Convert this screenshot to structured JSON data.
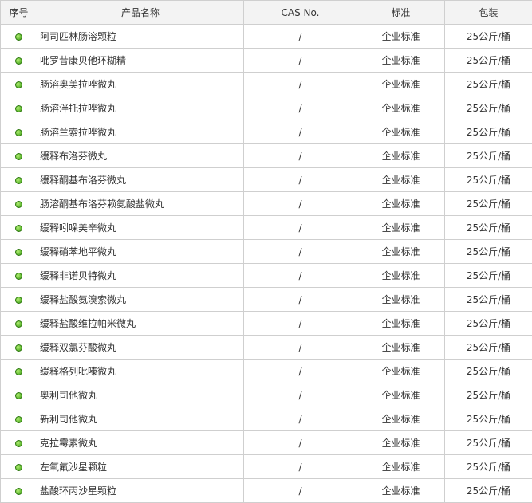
{
  "table": {
    "headers": [
      "序号",
      "产品名称",
      "CAS No.",
      "标准",
      "包装"
    ],
    "rows": [
      {
        "name": "阿司匹林肠溶颗粒",
        "cas": "/",
        "standard": "企业标准",
        "package": "25公斤/桶"
      },
      {
        "name": "吡罗昔康贝他环糊精",
        "cas": "/",
        "standard": "企业标准",
        "package": "25公斤/桶"
      },
      {
        "name": "肠溶奥美拉唑微丸",
        "cas": "/",
        "standard": "企业标准",
        "package": "25公斤/桶"
      },
      {
        "name": "肠溶泮托拉唑微丸",
        "cas": "/",
        "standard": "企业标准",
        "package": "25公斤/桶"
      },
      {
        "name": "肠溶兰索拉唑微丸",
        "cas": "/",
        "standard": "企业标准",
        "package": "25公斤/桶"
      },
      {
        "name": "缓释布洛芬微丸",
        "cas": "/",
        "standard": "企业标准",
        "package": "25公斤/桶"
      },
      {
        "name": "缓释酮基布洛芬微丸",
        "cas": "/",
        "standard": "企业标准",
        "package": "25公斤/桶"
      },
      {
        "name": "肠溶酮基布洛芬赖氨酸盐微丸",
        "cas": "/",
        "standard": "企业标准",
        "package": "25公斤/桶"
      },
      {
        "name": "缓释吲哚美辛微丸",
        "cas": "/",
        "standard": "企业标准",
        "package": "25公斤/桶"
      },
      {
        "name": "缓释硝苯地平微丸",
        "cas": "/",
        "standard": "企业标准",
        "package": "25公斤/桶"
      },
      {
        "name": "缓释非诺贝特微丸",
        "cas": "/",
        "standard": "企业标准",
        "package": "25公斤/桶"
      },
      {
        "name": "缓释盐酸氨溴索微丸",
        "cas": "/",
        "standard": "企业标准",
        "package": "25公斤/桶"
      },
      {
        "name": "缓释盐酸维拉帕米微丸",
        "cas": "/",
        "standard": "企业标准",
        "package": "25公斤/桶"
      },
      {
        "name": "缓释双氯芬酸微丸",
        "cas": "/",
        "standard": "企业标准",
        "package": "25公斤/桶"
      },
      {
        "name": "缓释格列吡嗪微丸",
        "cas": "/",
        "standard": "企业标准",
        "package": "25公斤/桶"
      },
      {
        "name": "奥利司他微丸",
        "cas": "/",
        "standard": "企业标准",
        "package": "25公斤/桶"
      },
      {
        "name": "新利司他微丸",
        "cas": "/",
        "standard": "企业标准",
        "package": "25公斤/桶"
      },
      {
        "name": "克拉霉素微丸",
        "cas": "/",
        "standard": "企业标准",
        "package": "25公斤/桶"
      },
      {
        "name": "左氧氟沙星颗粒",
        "cas": "/",
        "standard": "企业标准",
        "package": "25公斤/桶"
      },
      {
        "name": "盐酸环丙沙星颗粒",
        "cas": "/",
        "standard": "企业标准",
        "package": "25公斤/桶"
      }
    ]
  },
  "icons": {
    "row_marker": "green-dot-icon"
  },
  "colors": {
    "header_bg": "#f3f3f3",
    "border": "#cfcfcf",
    "dot": "#6cc13a"
  }
}
